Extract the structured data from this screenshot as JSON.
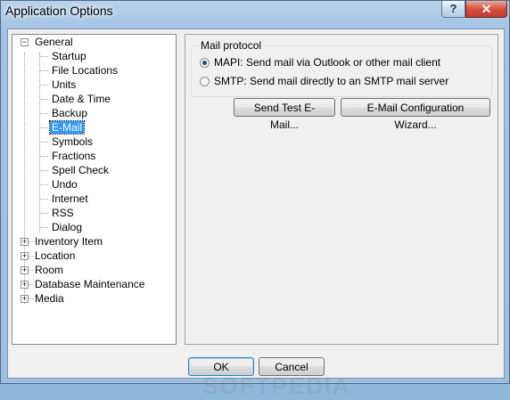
{
  "window": {
    "title": "Application Options",
    "help_label": "?",
    "close_label": "✕"
  },
  "tree": {
    "general_label": "General",
    "general_expander": "−",
    "children": [
      "Startup",
      "File Locations",
      "Units",
      "Date & Time",
      "Backup",
      "E-Mail",
      "Symbols",
      "Fractions",
      "Spell Check",
      "Undo",
      "Internet",
      "RSS",
      "Dialog"
    ],
    "selected_index": 5,
    "collapsed_expander": "+",
    "roots": [
      "Inventory Item",
      "Location",
      "Room",
      "Database Maintenance",
      "Media"
    ]
  },
  "mail": {
    "group_title": "Mail protocol",
    "option_mapi": "MAPI: Send mail via Outlook or other mail client",
    "option_smtp": "SMTP: Send mail directly to an SMTP mail server",
    "selected": "mapi",
    "test_button": "Send Test E-Mail...",
    "wizard_button": "E-Mail Configuration Wizard..."
  },
  "footer": {
    "ok_label": "OK",
    "cancel_label": "Cancel"
  },
  "watermark": "SOFTPEDIA"
}
